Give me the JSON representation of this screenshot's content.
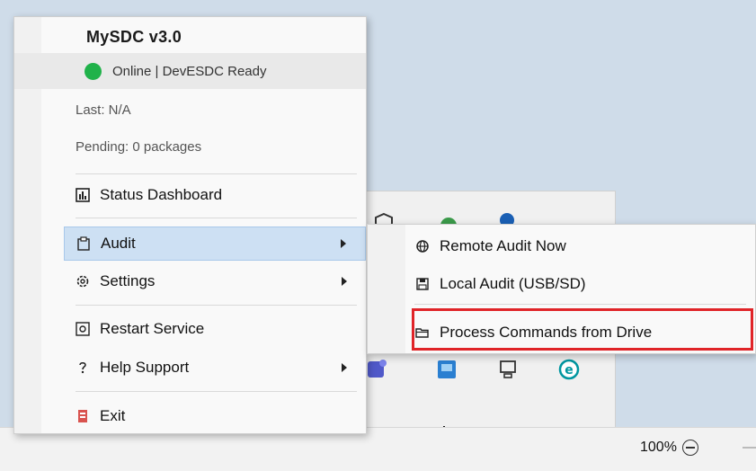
{
  "menu": {
    "title": "MySDC  v3.0",
    "status": "Online  |  DevESDC Ready",
    "last": "Last: N/A",
    "pending": "Pending: 0 packages",
    "items": [
      {
        "label": "Status Dashboard",
        "icon": "bar-chart-icon"
      },
      {
        "label": "Audit",
        "icon": "clipboard-icon"
      },
      {
        "label": "Settings",
        "icon": "gear-icon"
      },
      {
        "label": "Restart Service",
        "icon": "restart-icon"
      },
      {
        "label": "Help  Support",
        "icon": "help-icon"
      },
      {
        "label": "Exit",
        "icon": "exit-icon"
      }
    ]
  },
  "submenu": {
    "items": [
      {
        "label": "Remote Audit Now",
        "icon": "globe-icon"
      },
      {
        "label": "Local Audit (USB/SD)",
        "icon": "floppy-icon"
      },
      {
        "label": "Process Commands from Drive",
        "icon": "folder-icon"
      }
    ]
  },
  "taskbar": {
    "zoom": "100%"
  },
  "colors": {
    "online_dot": "#20b24a",
    "hover_highlight": "#cde0f3",
    "callout_red": "#e02428"
  }
}
